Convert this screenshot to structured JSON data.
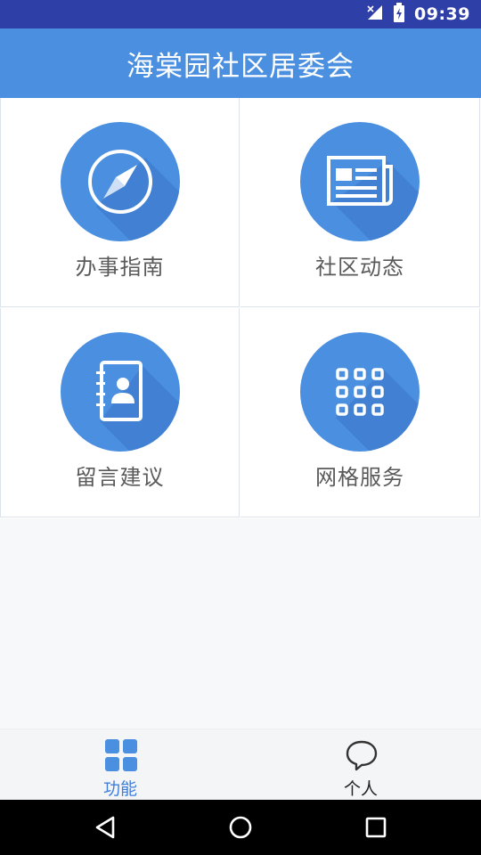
{
  "status_bar": {
    "time": "09:39",
    "icons": [
      "no-signal-icon",
      "battery-charging-icon"
    ]
  },
  "app_bar": {
    "title": "海棠园社区居委会"
  },
  "menu": {
    "items": [
      {
        "label": "办事指南",
        "icon": "compass-icon"
      },
      {
        "label": "社区动态",
        "icon": "newspaper-icon"
      },
      {
        "label": "留言建议",
        "icon": "contact-book-icon"
      },
      {
        "label": "网格服务",
        "icon": "grid-apps-icon"
      }
    ]
  },
  "tab_bar": {
    "tabs": [
      {
        "label": "功能",
        "icon": "four-squares-icon",
        "active": true
      },
      {
        "label": "个人",
        "icon": "chat-bubble-icon",
        "active": false
      }
    ]
  },
  "nav_bar": {
    "buttons": [
      "back-triangle-icon",
      "home-circle-icon",
      "recents-square-icon"
    ]
  },
  "colors": {
    "accent": "#4a8fe0",
    "status_bar": "#2f3fa8",
    "active_tab": "#3f7fdb"
  }
}
